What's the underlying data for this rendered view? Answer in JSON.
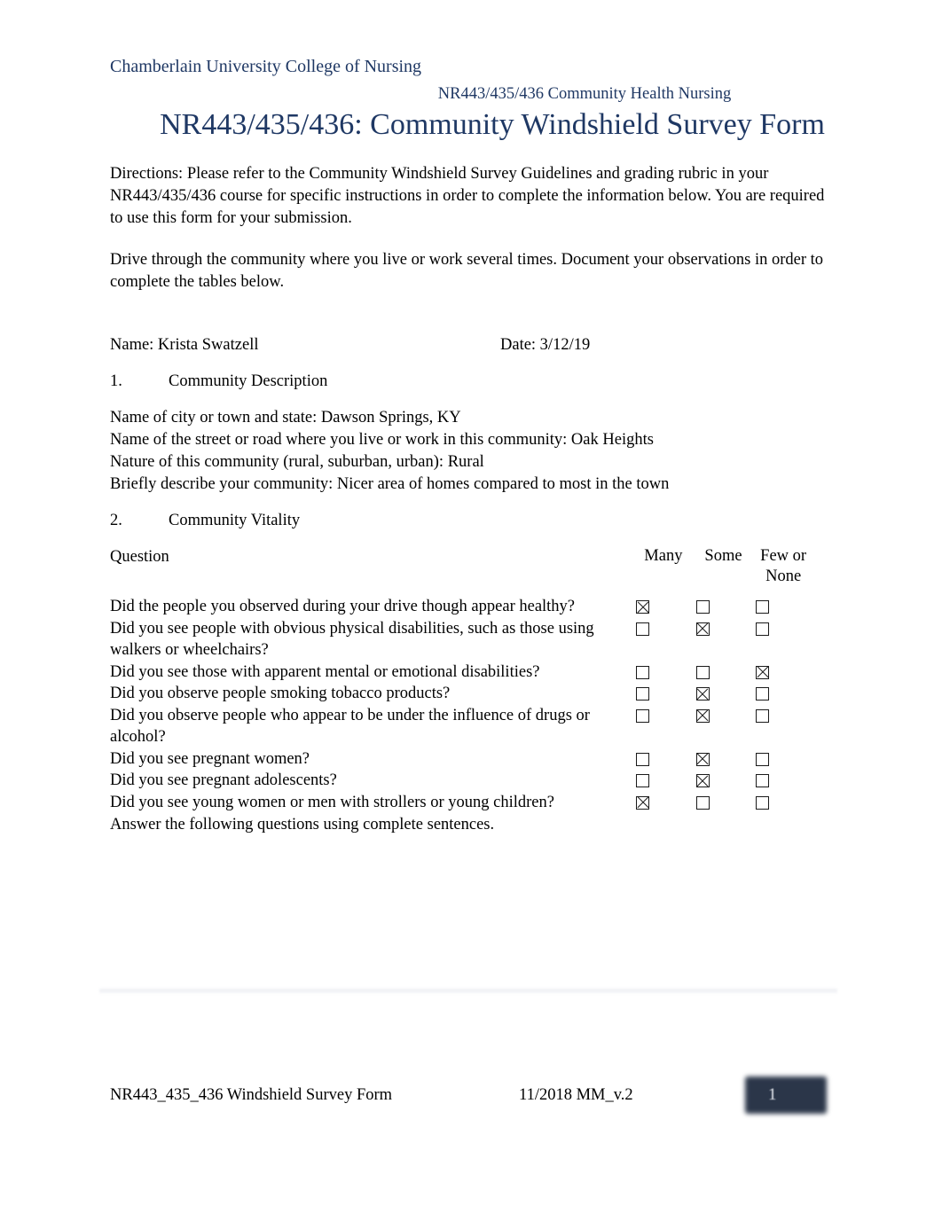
{
  "header": {
    "organization": "Chamberlain University College of Nursing",
    "course_line": "NR443/435/436 Community Health Nursing",
    "document_title": "NR443/435/436: Community Windshield Survey Form",
    "accent_color": "#1F3864"
  },
  "directions": {
    "paragraph_1": "Directions: Please refer to the Community Windshield Survey Guidelines and grading rubric in your NR443/435/436 course for specific instructions in order to complete the information below. You are required to use this form for your submission.",
    "paragraph_2": "Drive through the community where you live or work several times. Document your observations in order to complete the tables below."
  },
  "identity": {
    "name_label": "Name:",
    "name_value": "Krista Swatzell",
    "date_label": "Date:",
    "date_value": "3/12/19",
    "name_line": "Name:  Krista Swatzell",
    "date_line": "Date: 3/12/19"
  },
  "section_1": {
    "number": "1.",
    "title": "Community Description",
    "fields": [
      "Name of city or town and state: Dawson Springs, KY",
      "Name of the street or road where you live or work in this community:   Oak Heights",
      "Nature of this community (rural, suburban, urban): Rural",
      "Briefly describe your community: Nicer area of homes compared to most in the town"
    ]
  },
  "section_2": {
    "number": "2.",
    "title": "Community Vitality",
    "table": {
      "headers": {
        "question": "Question",
        "many": "Many",
        "some": "Some",
        "few_or_none": "Few or None"
      },
      "rows": [
        {
          "question": "Did the people you observed during your drive though appear healthy?",
          "many": true,
          "some": false,
          "few_or_none": false
        },
        {
          "question": "Did you see people with obvious physical disabilities, such as those using walkers or wheelchairs?",
          "many": false,
          "some": true,
          "few_or_none": false
        },
        {
          "question": "Did you see those with apparent mental or emotional disabilities?",
          "many": false,
          "some": false,
          "few_or_none": true
        },
        {
          "question": "Did you observe people smoking tobacco products?",
          "many": false,
          "some": true,
          "few_or_none": false
        },
        {
          "question": "Did you observe people who appear to be under the influence of drugs or alcohol?",
          "many": false,
          "some": true,
          "few_or_none": false
        },
        {
          "question": "Did you see pregnant women?",
          "many": false,
          "some": true,
          "few_or_none": false
        },
        {
          "question": "Did you see pregnant adolescents?",
          "many": false,
          "some": true,
          "few_or_none": false
        },
        {
          "question": "Did you see young women or men with strollers or young children?",
          "many": true,
          "some": false,
          "few_or_none": false
        }
      ]
    },
    "closing_note": "Answer the following questions using complete sentences."
  },
  "footer": {
    "left": "NR443_435_436 Windshield Survey Form",
    "center": "11/2018 MM_v.2",
    "page_number": "1",
    "page_number_bg": "#2b3649"
  }
}
